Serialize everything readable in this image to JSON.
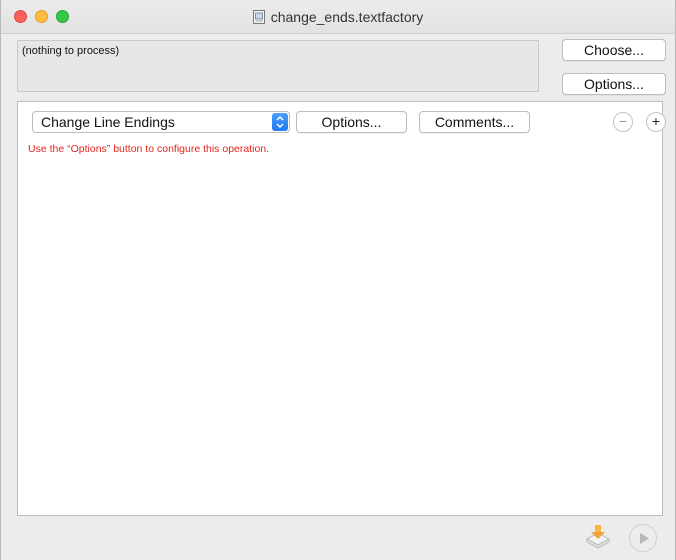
{
  "window": {
    "title": "change_ends.textfactory"
  },
  "source": {
    "text": "(nothing to process)",
    "choose_label": "Choose...",
    "options_label": "Options..."
  },
  "operation": {
    "selected": "Change Line Endings",
    "options_label": "Options...",
    "comments_label": "Comments...",
    "remove_label": "−",
    "add_label": "+",
    "hint": "Use the “Options” button to configure this operation."
  },
  "colors": {
    "hint": "#e2251d",
    "accent": "#1f79f2"
  }
}
